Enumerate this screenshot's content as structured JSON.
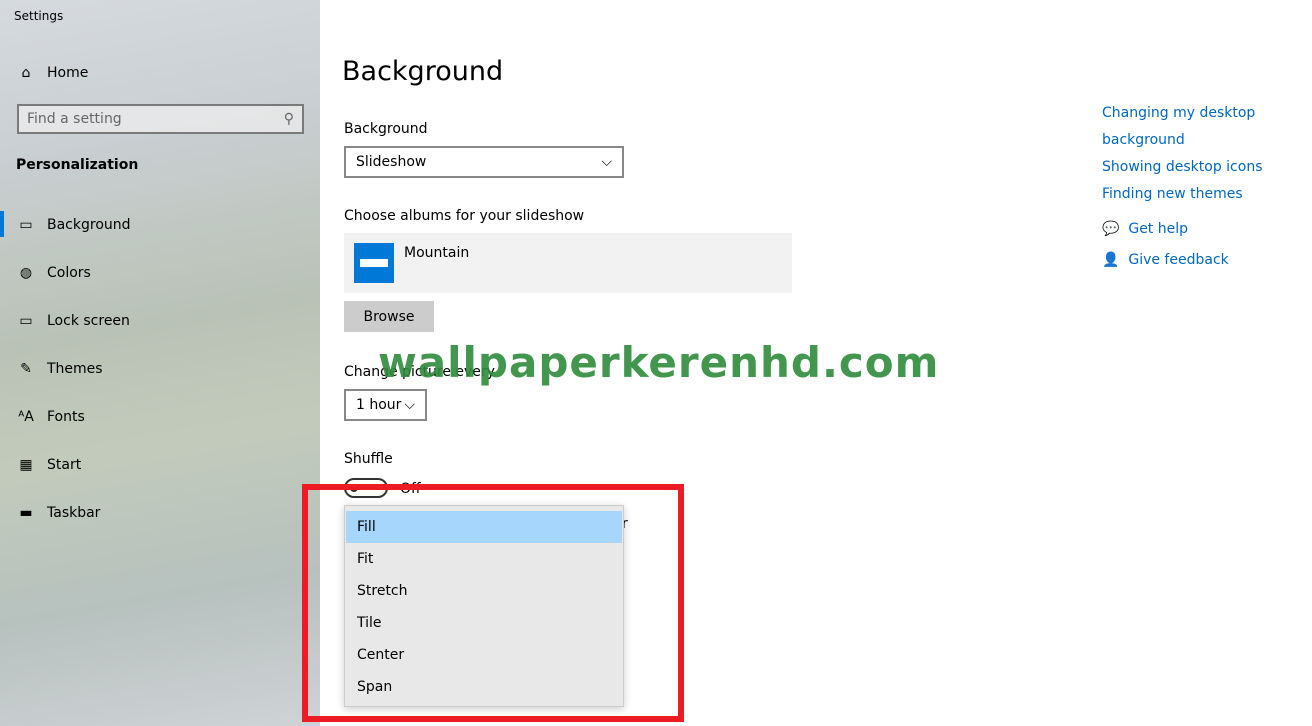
{
  "window": {
    "title": "Settings"
  },
  "sidebar": {
    "home": "Home",
    "search_placeholder": "Find a setting",
    "section": "Personalization",
    "items": [
      {
        "label": "Background",
        "icon": "image-icon"
      },
      {
        "label": "Colors",
        "icon": "palette-icon"
      },
      {
        "label": "Lock screen",
        "icon": "lock-screen-icon"
      },
      {
        "label": "Themes",
        "icon": "themes-icon"
      },
      {
        "label": "Fonts",
        "icon": "fonts-icon"
      },
      {
        "label": "Start",
        "icon": "start-icon"
      },
      {
        "label": "Taskbar",
        "icon": "taskbar-icon"
      }
    ],
    "selected": "Background"
  },
  "main": {
    "title": "Background",
    "background_label": "Background",
    "background_value": "Slideshow",
    "albums_label": "Choose albums for your slideshow",
    "album_name": "Mountain",
    "browse": "Browse",
    "change_label": "Change picture every",
    "change_value": "1 hour",
    "shuffle_label": "Shuffle",
    "shuffle_state": "Off",
    "fit_label_partial": "r",
    "fit_options": [
      "Fill",
      "Fit",
      "Stretch",
      "Tile",
      "Center",
      "Span"
    ],
    "fit_selected": "Fill"
  },
  "related": {
    "links": [
      "Changing my desktop background",
      "Showing desktop icons",
      "Finding new themes"
    ],
    "get_help": "Get help",
    "give_feedback": "Give feedback"
  },
  "watermark": "wallpaperkerenhd.com",
  "colors": {
    "accent": "#0078d7",
    "highlight": "#a6d6fb",
    "annotation": "#ed1c24"
  }
}
